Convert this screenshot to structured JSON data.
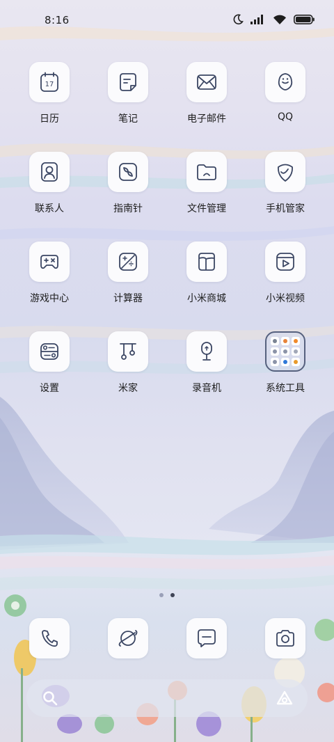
{
  "status_bar": {
    "time": "8:16",
    "icons": [
      "moon-icon",
      "signal-icon",
      "wifi-icon",
      "battery-icon"
    ]
  },
  "home": {
    "apps": [
      {
        "label": "日历",
        "icon": "calendar-icon",
        "calendar_day": "17"
      },
      {
        "label": "笔记",
        "icon": "notes-icon"
      },
      {
        "label": "电子邮件",
        "icon": "mail-icon"
      },
      {
        "label": "QQ",
        "icon": "qq-penguin-icon"
      },
      {
        "label": "联系人",
        "icon": "contact-icon"
      },
      {
        "label": "指南针",
        "icon": "compass-icon"
      },
      {
        "label": "文件管理",
        "icon": "folder-icon"
      },
      {
        "label": "手机管家",
        "icon": "shield-icon"
      },
      {
        "label": "游戏中心",
        "icon": "gamepad-icon"
      },
      {
        "label": "计算器",
        "icon": "calculator-icon"
      },
      {
        "label": "小米商城",
        "icon": "mi-store-icon"
      },
      {
        "label": "小米视频",
        "icon": "video-play-icon"
      },
      {
        "label": "设置",
        "icon": "settings-toggle-icon"
      },
      {
        "label": "米家",
        "icon": "mijia-icon"
      },
      {
        "label": "录音机",
        "icon": "microphone-icon"
      },
      {
        "label": "系统工具",
        "icon": "folder-group-icon",
        "is_folder": true
      }
    ],
    "folder_mini_icons": [
      {
        "color": "#7a8494"
      },
      {
        "color": "#e7833a"
      },
      {
        "color": "#f08a2a"
      },
      {
        "color": "#8b93a8"
      },
      {
        "color": "#8b93a8"
      },
      {
        "color": "#a2a8b8"
      },
      {
        "color": "#8b93a8"
      },
      {
        "color": "#2f78d8"
      },
      {
        "color": "#e89a2a"
      }
    ],
    "page_indicator": {
      "pages": 2,
      "current": 2
    }
  },
  "dock": {
    "apps": [
      {
        "icon": "phone-icon"
      },
      {
        "icon": "browser-planet-icon"
      },
      {
        "icon": "messages-icon"
      },
      {
        "icon": "camera-icon"
      }
    ]
  },
  "search_bar": {
    "icons": [
      "search-icon",
      "assistant-icon"
    ]
  }
}
